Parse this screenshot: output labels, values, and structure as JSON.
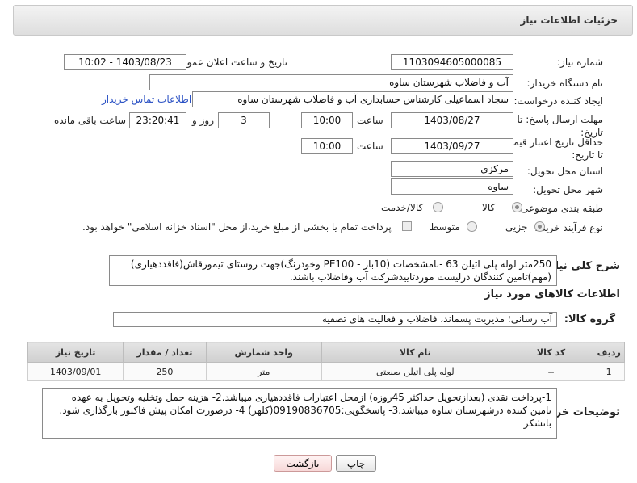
{
  "header": {
    "title": "جزئیات اطلاعات نیاز"
  },
  "fields": {
    "need_number_label": "شماره نیاز:",
    "need_number": "1103094605000085",
    "announce_label": "تاریخ و ساعت اعلان عمومی:",
    "announce_value": "1403/08/23 - 10:02",
    "buyer_org_label": "نام دستگاه خریدار:",
    "buyer_org": "آب و فاضلاب شهرستان ساوه",
    "requester_label": "ایجاد کننده درخواست:",
    "requester": "سجاد اسماعیلی کارشناس حسابداری آب و فاضلاب شهرستان ساوه",
    "contact_link": "اطلاعات تماس خریدار",
    "reply_deadline_label": "مهلت ارسال پاسخ: تا تاریخ:",
    "reply_date": "1403/08/27",
    "time_label": "ساعت",
    "reply_time": "10:00",
    "days_value": "3",
    "days_label": "روز و",
    "remaining_time": "23:20:41",
    "remaining_label": "ساعت باقی مانده",
    "price_validity_label": "حداقل تاریخ اعتبار قیمت: تا تاریخ:",
    "validity_date": "1403/09/27",
    "validity_time": "10:00",
    "province_label": "استان محل تحویل:",
    "province": "مرکزی",
    "city_label": "شهر محل تحویل:",
    "city": "ساوه",
    "category_label": "طبقه بندی موضوعی:",
    "category_options": [
      "کالا",
      "کالا/خدمت"
    ],
    "process_label": "نوع فرآیند خرید :",
    "process_options": [
      "جزیی",
      "متوسط"
    ],
    "payment_note": "پرداخت تمام یا بخشی از مبلغ خرید،از محل \"اسناد خزانه اسلامی\" خواهد بود."
  },
  "description": {
    "label": "شرح کلی نیاز:",
    "text": "250متر لوله پلی اتیلن 63 -بامشخصات (10بار - PE100 وخودرنگ)جهت روستای تیمورقاش(فاقددهیاری)(مهم)تامین کنندگان درلیست موردتاییدشرکت آب وفاضلاب باشند."
  },
  "goods_section": {
    "title": "اطلاعات کالاهای مورد نیاز",
    "group_label": "گروه کالا:",
    "group_value": "آب رسانی؛ مدیریت پسماند، فاضلاب و فعالیت های تصفیه"
  },
  "table": {
    "headers": [
      "ردیف",
      "کد کالا",
      "نام کالا",
      "واحد شمارش",
      "تعداد / مقدار",
      "تاریخ نیاز"
    ],
    "rows": [
      [
        "1",
        "--",
        "لوله پلی اتیلن صنعتی",
        "متر",
        "250",
        "1403/09/01"
      ]
    ]
  },
  "buyer_notes": {
    "label": "توضیحات خریدار:",
    "text": "1-پرداخت  نقدی (بعدازتحویل حداکثر 45روزه) ازمحل اعتبارات فاقددهیاری میباشد.2- هزینه حمل وتخلیه وتحویل به عهده تامین کننده درشهرستان ساوه میباشد.3- پاسخگویی:09190836705(کلهر) 4- درصورت امکان پیش فاکتور بارگذاری شود. باتشکر"
  },
  "buttons": {
    "print": "چاپ",
    "back": "بازگشت"
  },
  "colors": {
    "link": "#2a51c4",
    "back_button": "#f7d8d8"
  }
}
